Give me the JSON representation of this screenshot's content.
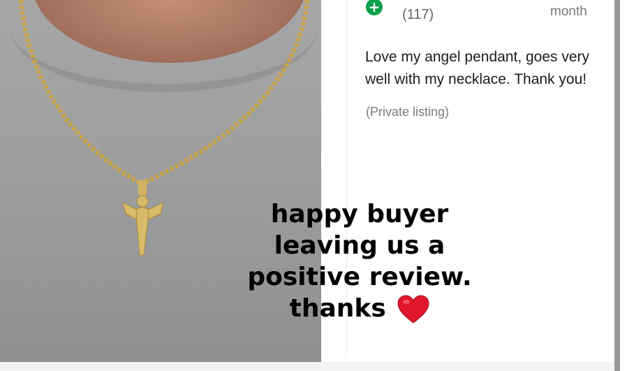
{
  "review": {
    "reviewer_count": "(117)",
    "date_text": "month",
    "text": "Love my angel pendant, goes very well with my necklace. Thank you!",
    "private_note": "(Private listing)"
  },
  "overlay": {
    "line1": "happy buyer",
    "line2": "leaving us a",
    "line3": "positive review.",
    "line4": "thanks"
  },
  "icons": {
    "plus": "plus-circle-icon",
    "heart": "red-heart-emoji-icon"
  },
  "colors": {
    "plus_green": "#0aa04a",
    "heart_red": "#e0162b",
    "shirt_gray": "#9c9c9c"
  }
}
